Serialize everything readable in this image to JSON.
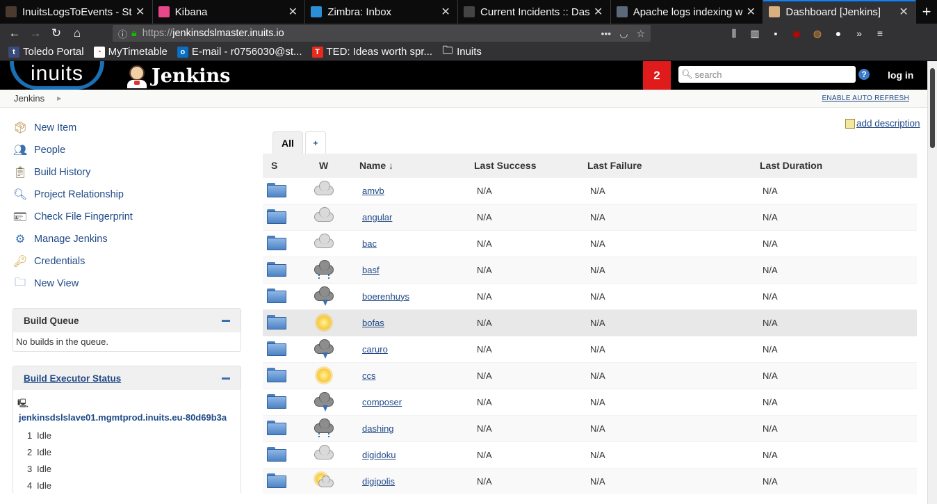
{
  "browser": {
    "tabs": [
      {
        "title": "InuitsLogsToEvents - St",
        "icon": "stripe-icon",
        "color": "#4a3a30"
      },
      {
        "title": "Kibana",
        "icon": "kibana-icon",
        "color": "#e8488b"
      },
      {
        "title": "Zimbra: Inbox",
        "icon": "zimbra-icon",
        "color": "#2b8fd6"
      },
      {
        "title": "Current Incidents :: Das",
        "icon": "incident-icon",
        "color": "#444444"
      },
      {
        "title": "Apache logs indexing w",
        "icon": "doc-icon",
        "color": "#5a6a7a"
      },
      {
        "title": "Dashboard [Jenkins]",
        "icon": "jenkins-icon",
        "color": "#d9b080",
        "active": true
      }
    ],
    "url_prefix": "https://",
    "url_host": "jenkinsdslmaster.inuits.io",
    "bookmarks": [
      {
        "label": "Toledo Portal",
        "icon": "t",
        "color": "#3a4a7a"
      },
      {
        "label": "MyTimetable",
        "icon": "◔",
        "color": "#ffffff"
      },
      {
        "label": "E-mail - r0756030@st...",
        "icon": "o",
        "color": "#0a6fc2"
      },
      {
        "label": "TED: Ideas worth spr...",
        "icon": "T",
        "color": "#e62b1e"
      },
      {
        "label": "Inuits",
        "icon": "folder",
        "color": "#323234"
      }
    ]
  },
  "header": {
    "brand": "inuits",
    "title": "Jenkins",
    "notifications": "2",
    "search_placeholder": "search",
    "help": "?",
    "login": "log in"
  },
  "breadcrumb": {
    "root": "Jenkins",
    "auto_refresh": "ENABLE AUTO REFRESH"
  },
  "tasks": [
    {
      "label": "New Item",
      "icon": "new-item-icon"
    },
    {
      "label": "People",
      "icon": "people-icon"
    },
    {
      "label": "Build History",
      "icon": "build-history-icon"
    },
    {
      "label": "Project Relationship",
      "icon": "magnifier-icon"
    },
    {
      "label": "Check File Fingerprint",
      "icon": "fingerprint-icon"
    },
    {
      "label": "Manage Jenkins",
      "icon": "gear-icon"
    },
    {
      "label": "Credentials",
      "icon": "keys-icon"
    },
    {
      "label": "New View",
      "icon": "folder-icon"
    }
  ],
  "build_queue": {
    "title": "Build Queue",
    "empty": "No builds in the queue."
  },
  "executors": {
    "title": "Build Executor Status",
    "host": "jenkinsdslslave01.mgmtprod.inuits.eu-80d69b3a",
    "rows": [
      {
        "n": "1",
        "state": "Idle"
      },
      {
        "n": "2",
        "state": "Idle"
      },
      {
        "n": "3",
        "state": "Idle"
      },
      {
        "n": "4",
        "state": "Idle"
      }
    ]
  },
  "main": {
    "add_description": "add description",
    "views": [
      "All",
      "+"
    ],
    "columns": [
      "S",
      "W",
      "Name ↓",
      "Last Success",
      "Last Failure",
      "Last Duration"
    ],
    "jobs": [
      {
        "name": "amvb",
        "weather": "cloudy",
        "last_success": "N/A",
        "last_failure": "N/A",
        "last_duration": "N/A"
      },
      {
        "name": "angular",
        "weather": "cloudy",
        "last_success": "N/A",
        "last_failure": "N/A",
        "last_duration": "N/A"
      },
      {
        "name": "bac",
        "weather": "cloudy",
        "last_success": "N/A",
        "last_failure": "N/A",
        "last_duration": "N/A"
      },
      {
        "name": "basf",
        "weather": "rain",
        "last_success": "N/A",
        "last_failure": "N/A",
        "last_duration": "N/A"
      },
      {
        "name": "boerenhuys",
        "weather": "storm",
        "last_success": "N/A",
        "last_failure": "N/A",
        "last_duration": "N/A"
      },
      {
        "name": "bofas",
        "weather": "sunny",
        "last_success": "N/A",
        "last_failure": "N/A",
        "last_duration": "N/A",
        "highlight": true
      },
      {
        "name": "caruro",
        "weather": "storm",
        "last_success": "N/A",
        "last_failure": "N/A",
        "last_duration": "N/A"
      },
      {
        "name": "ccs",
        "weather": "sunny",
        "last_success": "N/A",
        "last_failure": "N/A",
        "last_duration": "N/A"
      },
      {
        "name": "composer",
        "weather": "storm",
        "last_success": "N/A",
        "last_failure": "N/A",
        "last_duration": "N/A"
      },
      {
        "name": "dashing",
        "weather": "rain",
        "last_success": "N/A",
        "last_failure": "N/A",
        "last_duration": "N/A"
      },
      {
        "name": "digidoku",
        "weather": "cloudy",
        "last_success": "N/A",
        "last_failure": "N/A",
        "last_duration": "N/A"
      },
      {
        "name": "digipolis",
        "weather": "partly-sunny",
        "last_success": "N/A",
        "last_failure": "N/A",
        "last_duration": "N/A"
      }
    ]
  }
}
